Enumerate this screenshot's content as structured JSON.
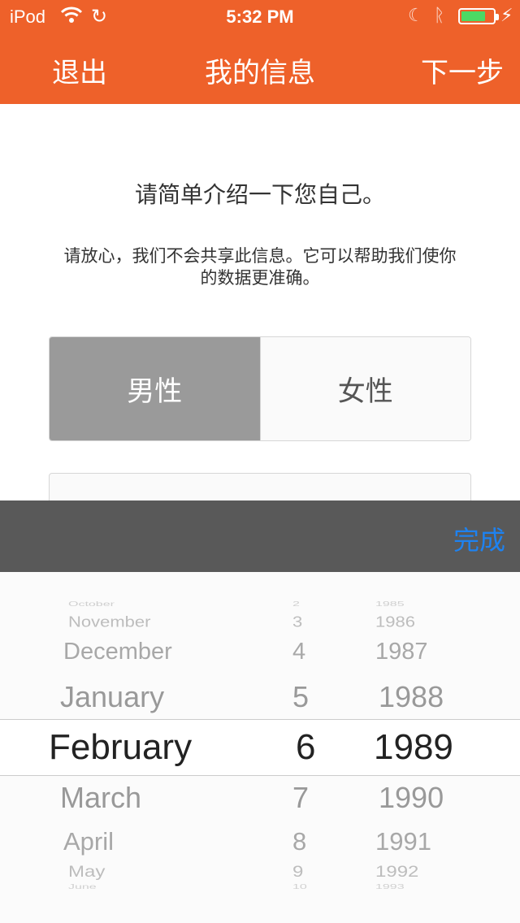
{
  "status_bar": {
    "carrier": "iPod",
    "wifi_icon": "wifi-icon",
    "sync_icon": "sync-icon",
    "time": "5:32 PM",
    "moon_icon": "do-not-disturb-icon",
    "bluetooth_icon": "bluetooth-icon",
    "battery_level": 0.75,
    "battery_color": "#4cd964"
  },
  "nav": {
    "left_label": "退出",
    "title": "我的信息",
    "right_label": "下一步",
    "bar_color": "#ee612a"
  },
  "content": {
    "headline": "请简单介绍一下您自己。",
    "subtext": "请放心，我们不会共享此信息。它可以帮助我们使你的数据更准确。"
  },
  "gender": {
    "options": [
      "男性",
      "女性"
    ],
    "selected": "男性"
  },
  "toolbar": {
    "done_label": "完成",
    "done_color": "#1e82f0"
  },
  "picker": {
    "rows": [
      {
        "month": "October",
        "day": "2",
        "year": "1985"
      },
      {
        "month": "November",
        "day": "3",
        "year": "1986"
      },
      {
        "month": "December",
        "day": "4",
        "year": "1987"
      },
      {
        "month": "January",
        "day": "5",
        "year": "1988"
      },
      {
        "month": "February",
        "day": "6",
        "year": "1989"
      },
      {
        "month": "March",
        "day": "7",
        "year": "1990"
      },
      {
        "month": "April",
        "day": "8",
        "year": "1991"
      },
      {
        "month": "May",
        "day": "9",
        "year": "1992"
      },
      {
        "month": "June",
        "day": "10",
        "year": "1993"
      }
    ],
    "selected": {
      "month": "February",
      "day": "6",
      "year": "1989"
    }
  }
}
